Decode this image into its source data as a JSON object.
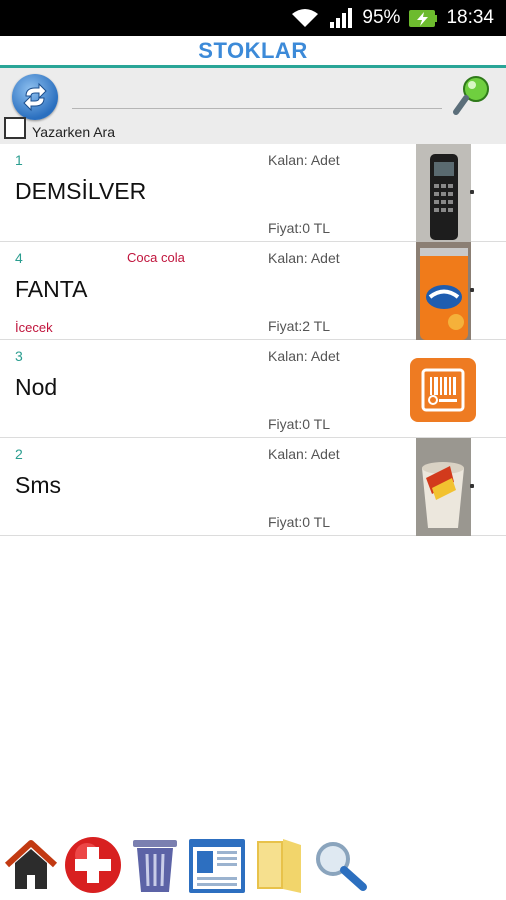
{
  "status": {
    "battery": "95%",
    "time": "18:34"
  },
  "header": {
    "title": "STOKLAR"
  },
  "search": {
    "value": "",
    "type_search_label": "Yazarken Ara"
  },
  "items": [
    {
      "num": "1",
      "name": "DEMSİLVER",
      "kalan": "Kalan: Adet",
      "fiyat": "Fiyat:0 TL",
      "note": "",
      "category": "",
      "thumb": "phone-photo"
    },
    {
      "num": "4",
      "name": "FANTA",
      "kalan": "Kalan: Adet",
      "fiyat": "Fiyat:2 TL",
      "note": "Coca cola",
      "category": "İcecek",
      "thumb": "fanta-can-photo"
    },
    {
      "num": "3",
      "name": "Nod",
      "kalan": "Kalan: Adet",
      "fiyat": "Fiyat:0 TL",
      "note": "",
      "category": "",
      "thumb": "barcode-icon"
    },
    {
      "num": "2",
      "name": "Sms",
      "kalan": "Kalan: Adet",
      "fiyat": "Fiyat:0 TL",
      "note": "",
      "category": "",
      "thumb": "cup-photo"
    }
  ],
  "toolbar": [
    "home-icon",
    "add-icon",
    "trash-icon",
    "list-view-icon",
    "folder-icon",
    "magnifier-icon"
  ],
  "colors": {
    "accent": "#3c8ad8",
    "divider": "#2aa597",
    "number": "#2a9d8f",
    "note": "#c0143c",
    "barcode_tile": "#ee7b22"
  }
}
